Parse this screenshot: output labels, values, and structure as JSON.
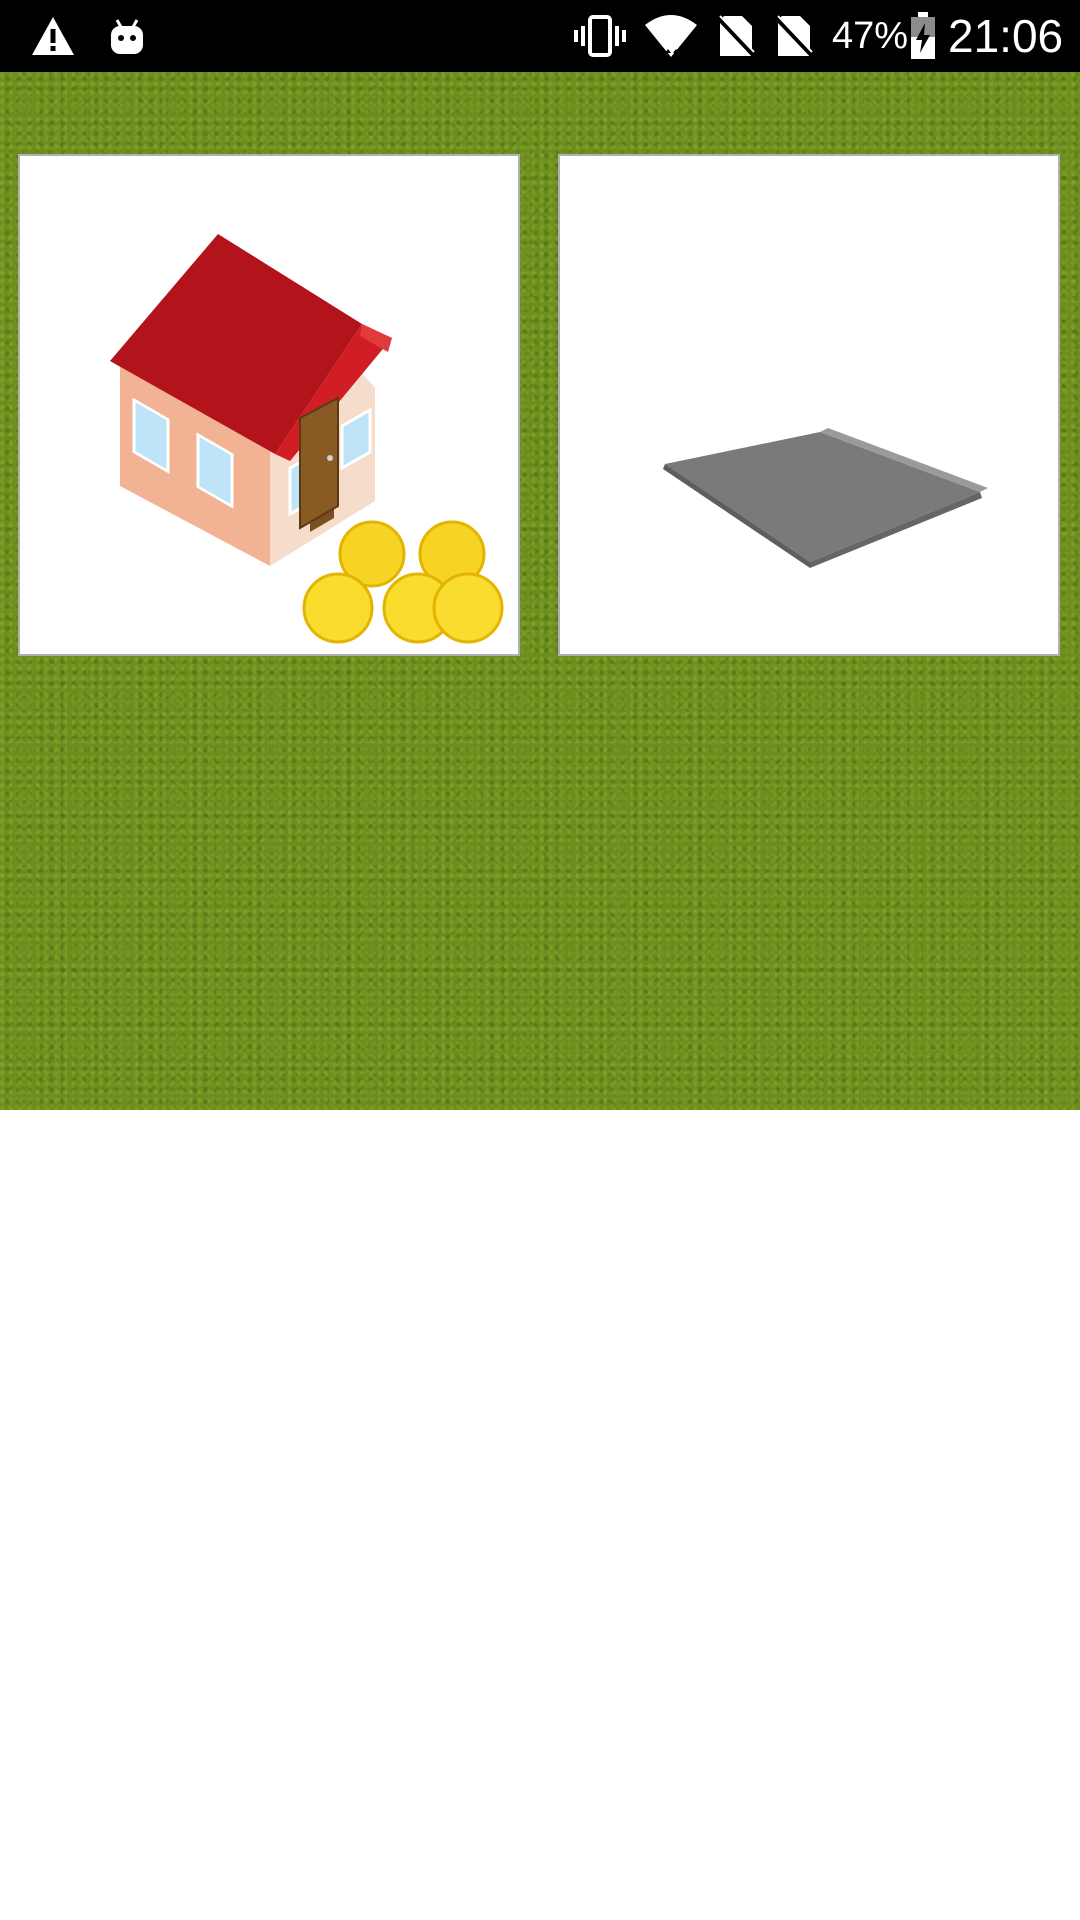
{
  "status_bar": {
    "battery_percent": "47%",
    "time": "21:06",
    "icons": [
      "warning-icon",
      "android-icon",
      "vibrate-icon",
      "wifi-icon",
      "no-sim-icon",
      "no-sim-icon",
      "battery-charging-icon"
    ]
  },
  "tiles": [
    {
      "id": "house-with-coins",
      "icon": "house-coins-icon"
    },
    {
      "id": "empty-plot",
      "icon": "empty-plot-icon"
    }
  ],
  "colors": {
    "grass": "#6d8e1f",
    "roof": "#b3141b",
    "coin": "#f5d21e",
    "plot": "#7a7a7a"
  }
}
